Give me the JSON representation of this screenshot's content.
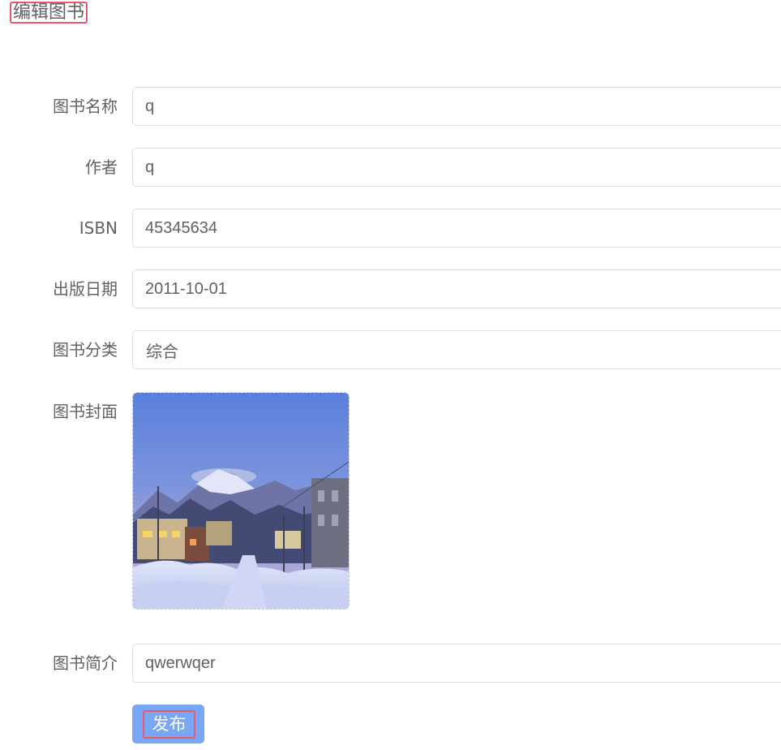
{
  "page": {
    "title": "编辑图书"
  },
  "form": {
    "fields": [
      {
        "label": "图书名称",
        "value": "q"
      },
      {
        "label": "作者",
        "value": "q"
      },
      {
        "label": "ISBN",
        "value": "45345634"
      },
      {
        "label": "出版日期",
        "value": "2011-10-01"
      },
      {
        "label": "图书分类",
        "value": "综合"
      }
    ],
    "cover": {
      "label": "图书封面",
      "image_description_icon": "snowy-mountain-town-photo"
    },
    "summary": {
      "label": "图书简介",
      "value": "qwerwqer"
    },
    "submit_label": "发布"
  },
  "colors": {
    "primary_button": "#79a6f5",
    "highlight_border": "#e8596e",
    "input_border": "#dcdfe6",
    "label_text": "#606266"
  }
}
